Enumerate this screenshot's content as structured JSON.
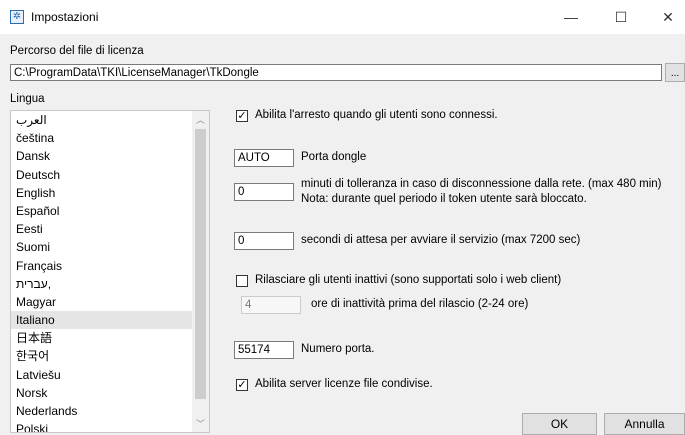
{
  "window": {
    "title": "Impostazioni",
    "icon": "settings-gear-icon",
    "minimize": "—",
    "maximize": "☐",
    "close": "✕"
  },
  "license_path": {
    "label": "Percorso del file di licenza",
    "value": "C:\\ProgramData\\TKI\\LicenseManager\\TkDongle",
    "browse_label": "..."
  },
  "language": {
    "label": "Lingua",
    "items": [
      "العرب",
      "čeština",
      "Dansk",
      "Deutsch",
      "English",
      "Español",
      "Eesti",
      "Suomi",
      "Français",
      "עברית,",
      "Magyar",
      "Italiano",
      "日本語",
      "한국어",
      "Latviešu",
      "Norsk",
      "Nederlands",
      "Polski"
    ],
    "selected": "Italiano"
  },
  "settings": {
    "stop_when_connected": {
      "label": "Abilita l'arresto quando gli utenti sono connessi.",
      "checked": true
    },
    "dongle_port": {
      "value": "AUTO",
      "label": "Porta dongle"
    },
    "tolerance": {
      "value": "0",
      "label_line1": "minuti di tolleranza in caso di disconnessione dalla rete. (max 480 min)",
      "label_line2": "Nota: durante quel periodo il token utente sarà bloccato."
    },
    "wait_seconds": {
      "value": "0",
      "label": "secondi di attesa per avviare il servizio (max 7200 sec)"
    },
    "release_inactive": {
      "label": "Rilasciare gli utenti inattivi (sono supportati solo i web client)",
      "checked": false
    },
    "inactive_hours": {
      "value": "4",
      "label": "ore di inattività prima del rilascio (2-24 ore)"
    },
    "port_number": {
      "value": "55174",
      "label": "Numero porta."
    },
    "shared_files": {
      "label": "Abilita server licenze file condivise.",
      "checked": true
    }
  },
  "buttons": {
    "ok": "OK",
    "cancel": "Annulla"
  }
}
